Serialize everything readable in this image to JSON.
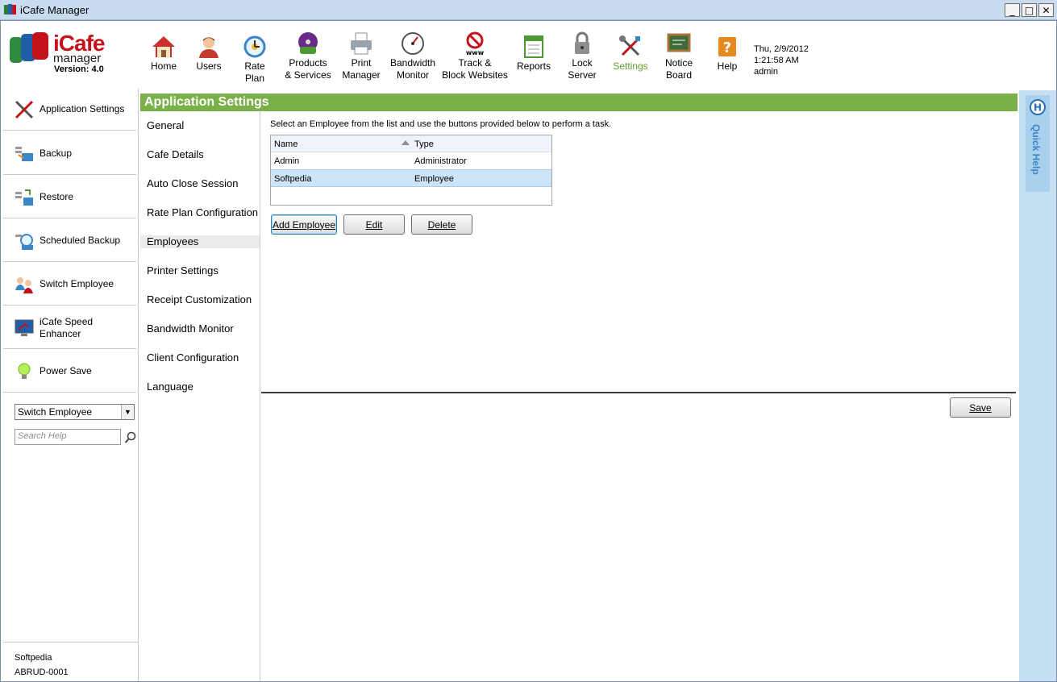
{
  "window": {
    "title": "iCafe Manager",
    "minimize": "_",
    "maximize": "□",
    "close": "✕"
  },
  "logo": {
    "brand": "iCafe",
    "sub": "manager",
    "version": "Version: 4.0"
  },
  "toolbar": {
    "items": [
      {
        "label": "Home",
        "icon": "home-icon"
      },
      {
        "label": "Users",
        "icon": "users-icon"
      },
      {
        "label": "Rate\nPlan",
        "icon": "rate-plan-icon"
      },
      {
        "label": "Products\n& Services",
        "icon": "products-icon"
      },
      {
        "label": "Print\nManager",
        "icon": "printer-icon"
      },
      {
        "label": "Bandwidth\nMonitor",
        "icon": "gauge-icon"
      },
      {
        "label": "Track &\nBlock Websites",
        "icon": "block-www-icon"
      },
      {
        "label": "Reports",
        "icon": "reports-icon"
      },
      {
        "label": "Lock\nServer",
        "icon": "lock-icon"
      },
      {
        "label": "Settings",
        "icon": "settings-icon"
      },
      {
        "label": "Notice\nBoard",
        "icon": "notice-board-icon"
      },
      {
        "label": "Help",
        "icon": "help-icon"
      }
    ],
    "active": "Settings",
    "active_color": "#5aa02c"
  },
  "status": {
    "date": "Thu, 2/9/2012",
    "time": "1:21:58 AM",
    "user": "admin"
  },
  "sidebar": {
    "items": [
      {
        "label": "Application Settings",
        "icon": "app-settings-icon"
      },
      {
        "label": "Backup",
        "icon": "backup-icon"
      },
      {
        "label": "Restore",
        "icon": "restore-icon"
      },
      {
        "label": "Scheduled Backup",
        "icon": "scheduled-backup-icon"
      },
      {
        "label": "Switch Employee",
        "icon": "switch-employee-icon"
      },
      {
        "label": "iCafe Speed\nEnhancer",
        "icon": "speed-enhancer-icon"
      },
      {
        "label": "Power Save",
        "icon": "lightbulb-icon"
      }
    ],
    "employee_select": "Switch Employee",
    "search_placeholder": "Search Help",
    "footer_name": "Softpedia",
    "footer_id": "ABRUD-0001"
  },
  "section": {
    "title": "Application Settings",
    "header_color": "#79b04a"
  },
  "settings_nav": {
    "items": [
      "General",
      "Cafe Details",
      "Auto Close Session",
      "Rate Plan Configuration",
      "Employees",
      "Printer Settings",
      "Receipt Customization",
      "Bandwidth Monitor",
      "Client Configuration",
      "Language"
    ],
    "active": "Employees"
  },
  "employees": {
    "instructions": "Select an Employee from the list and use the buttons provided below to perform a task.",
    "columns": [
      "Name",
      "Type"
    ],
    "rows": [
      {
        "name": "Admin",
        "type": "Administrator",
        "selected": false
      },
      {
        "name": "Softpedia",
        "type": "Employee",
        "selected": true
      }
    ],
    "add_label": "Add Employee",
    "edit_label": "Edit",
    "delete_label": "Delete",
    "save_label": "Save"
  },
  "quick_help": {
    "label": "Quick Help"
  }
}
